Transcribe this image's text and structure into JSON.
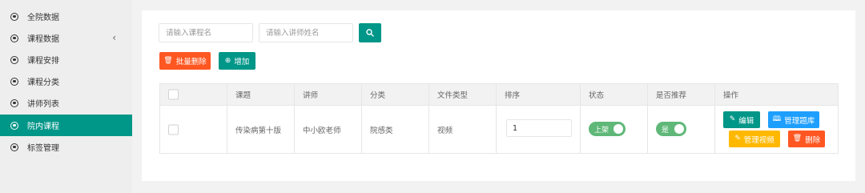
{
  "sidebar": {
    "items": [
      {
        "label": "全院数据",
        "active": false
      },
      {
        "label": "课程数据",
        "active": false,
        "arrow": "‹"
      },
      {
        "label": "课程安排",
        "active": false
      },
      {
        "label": "课程分类",
        "active": false
      },
      {
        "label": "讲师列表",
        "active": false
      },
      {
        "label": "院内课程",
        "active": true
      },
      {
        "label": "标签管理",
        "active": false
      }
    ]
  },
  "search": {
    "course_placeholder": "请输入课程名",
    "teacher_placeholder": "请输入讲师姓名",
    "button_icon": "search-icon"
  },
  "toolbar": {
    "batch_delete_label": "批量删除",
    "batch_delete_icon": "trash-icon",
    "add_label": "增加",
    "add_icon": "plus-circle-icon"
  },
  "table": {
    "headers": [
      "课题",
      "讲师",
      "分类",
      "文件类型",
      "排序",
      "状态",
      "是否推荐",
      "操作"
    ],
    "rows": [
      {
        "title": "传染病第十版",
        "teacher": "中小欧老师",
        "category": "院感类",
        "file_type": "视频",
        "sort": "1",
        "status_label": "上架",
        "recommend_label": "是",
        "actions": {
          "edit": "编辑",
          "manage_questions": "管理题库",
          "manage_video": "管理视频",
          "delete": "删除"
        }
      }
    ]
  },
  "colors": {
    "primary": "#009688",
    "danger": "#ff5722",
    "blue": "#1e9fff",
    "warn": "#ffb800",
    "switch_on": "#5fb878"
  }
}
